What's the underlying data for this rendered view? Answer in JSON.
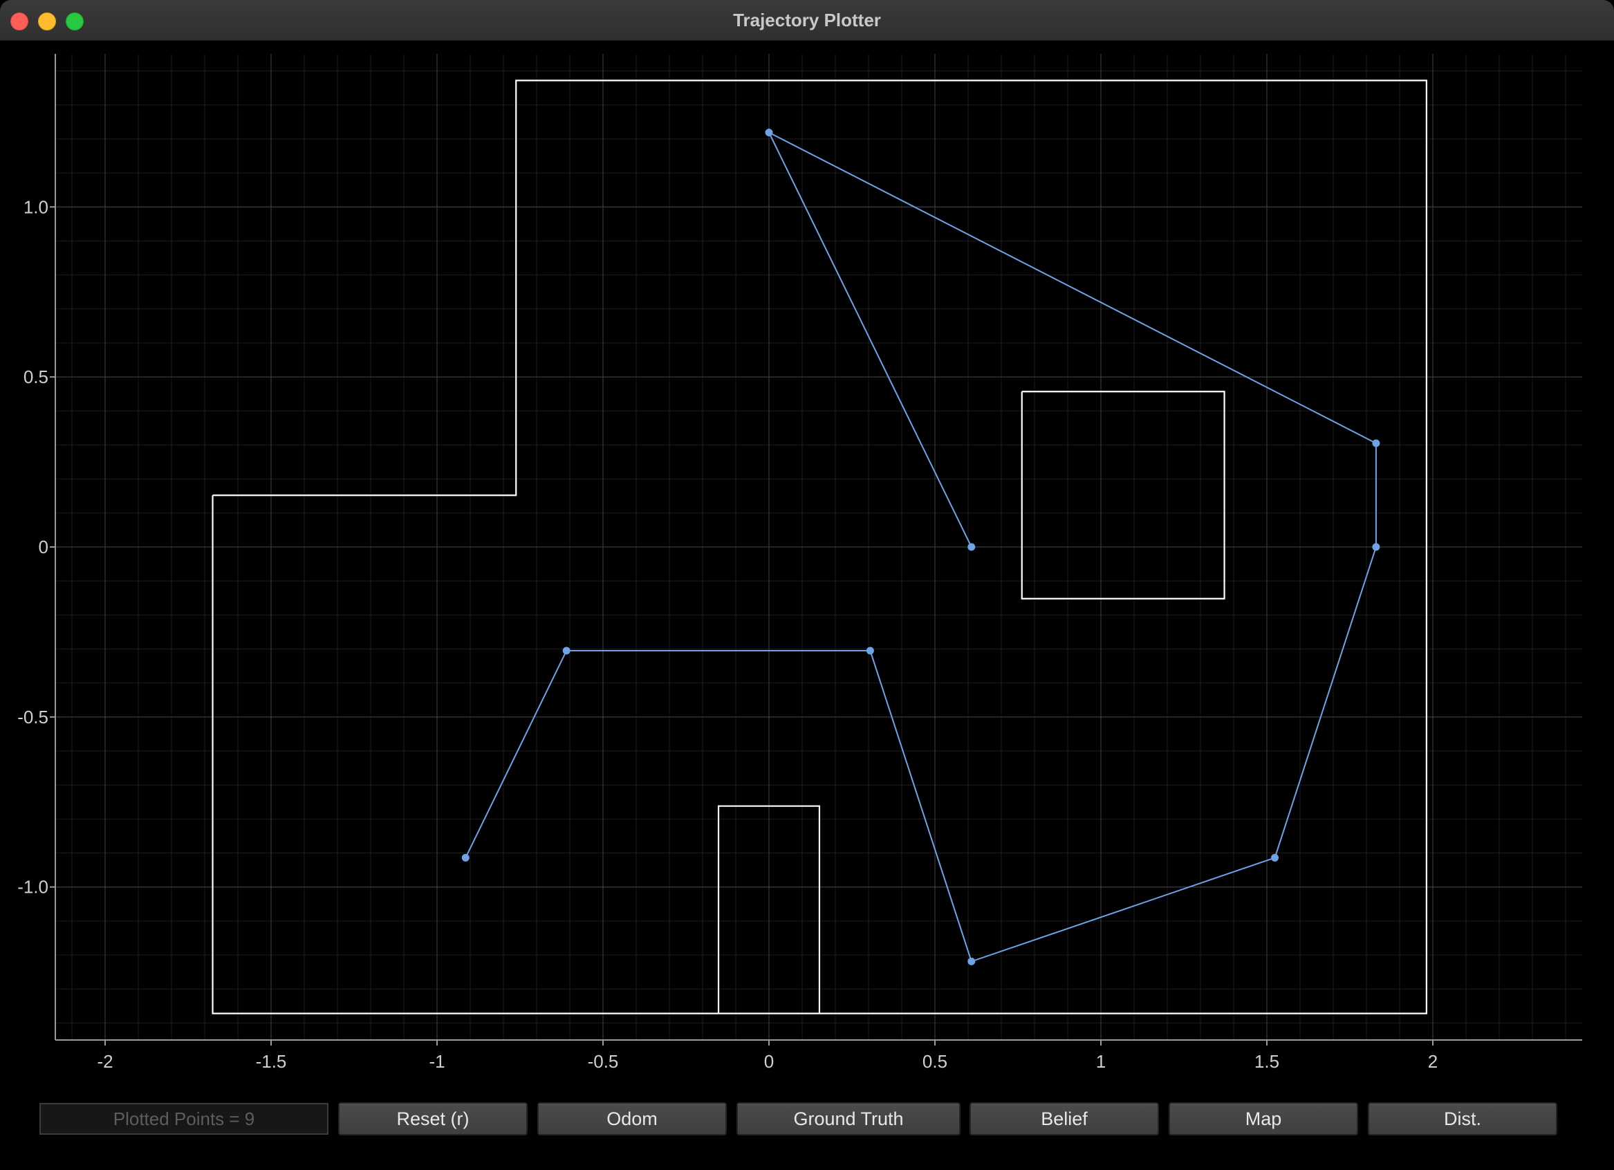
{
  "window": {
    "title": "Trajectory Plotter"
  },
  "controls": {
    "plotted_points_label": "Plotted Points = 9",
    "buttons": [
      "Reset (r)",
      "Odom",
      "Ground Truth",
      "Belief",
      "Map",
      "Dist."
    ]
  },
  "colors": {
    "background": "#000000",
    "trajectory": "#6fa3e8",
    "map": "#ffffff",
    "grid_major": "#3a3a3a",
    "grid_minor": "#1c1c1c",
    "axis": "#9a9a9a"
  },
  "chart_data": {
    "type": "line",
    "title": "",
    "xlabel": "",
    "ylabel": "",
    "xlim": [
      -2.15,
      2.45
    ],
    "ylim": [
      -1.45,
      1.45
    ],
    "x_ticks": [
      -2,
      -1.5,
      -1,
      -0.5,
      0,
      0.5,
      1,
      1.5,
      2
    ],
    "x_tick_labels": [
      "-2",
      "-1.5",
      "-1",
      "-0.5",
      "0",
      "0.5",
      "1",
      "1.5",
      "2"
    ],
    "y_ticks": [
      1.0,
      0.5,
      0,
      -0.5,
      -1.0
    ],
    "y_tick_labels": [
      "1.0",
      "0.5",
      "0",
      "-0.5",
      "-1.0"
    ],
    "grid": true,
    "series": [
      {
        "x": [
          -0.914,
          -0.61,
          0.305,
          0.61,
          1.524,
          1.829,
          1.829,
          0.0,
          0.61
        ],
        "y": [
          -0.914,
          -0.305,
          -0.305,
          -1.219,
          -0.914,
          0.0,
          0.305,
          1.219,
          0.0
        ]
      }
    ],
    "map_polylines": [
      {
        "x": [
          -1.676,
          -1.676,
          1.981,
          1.981,
          -0.762,
          -0.762,
          -1.676
        ],
        "y": [
          0.152,
          -1.372,
          -1.372,
          1.372,
          1.372,
          0.152,
          0.152
        ]
      },
      {
        "x": [
          0.762,
          1.372,
          1.372,
          0.762,
          0.762
        ],
        "y": [
          0.457,
          0.457,
          -0.152,
          -0.152,
          0.457
        ]
      },
      {
        "x": [
          -0.152,
          -0.152,
          0.152,
          0.152
        ],
        "y": [
          -1.372,
          -0.762,
          -0.762,
          -1.372
        ]
      }
    ]
  }
}
